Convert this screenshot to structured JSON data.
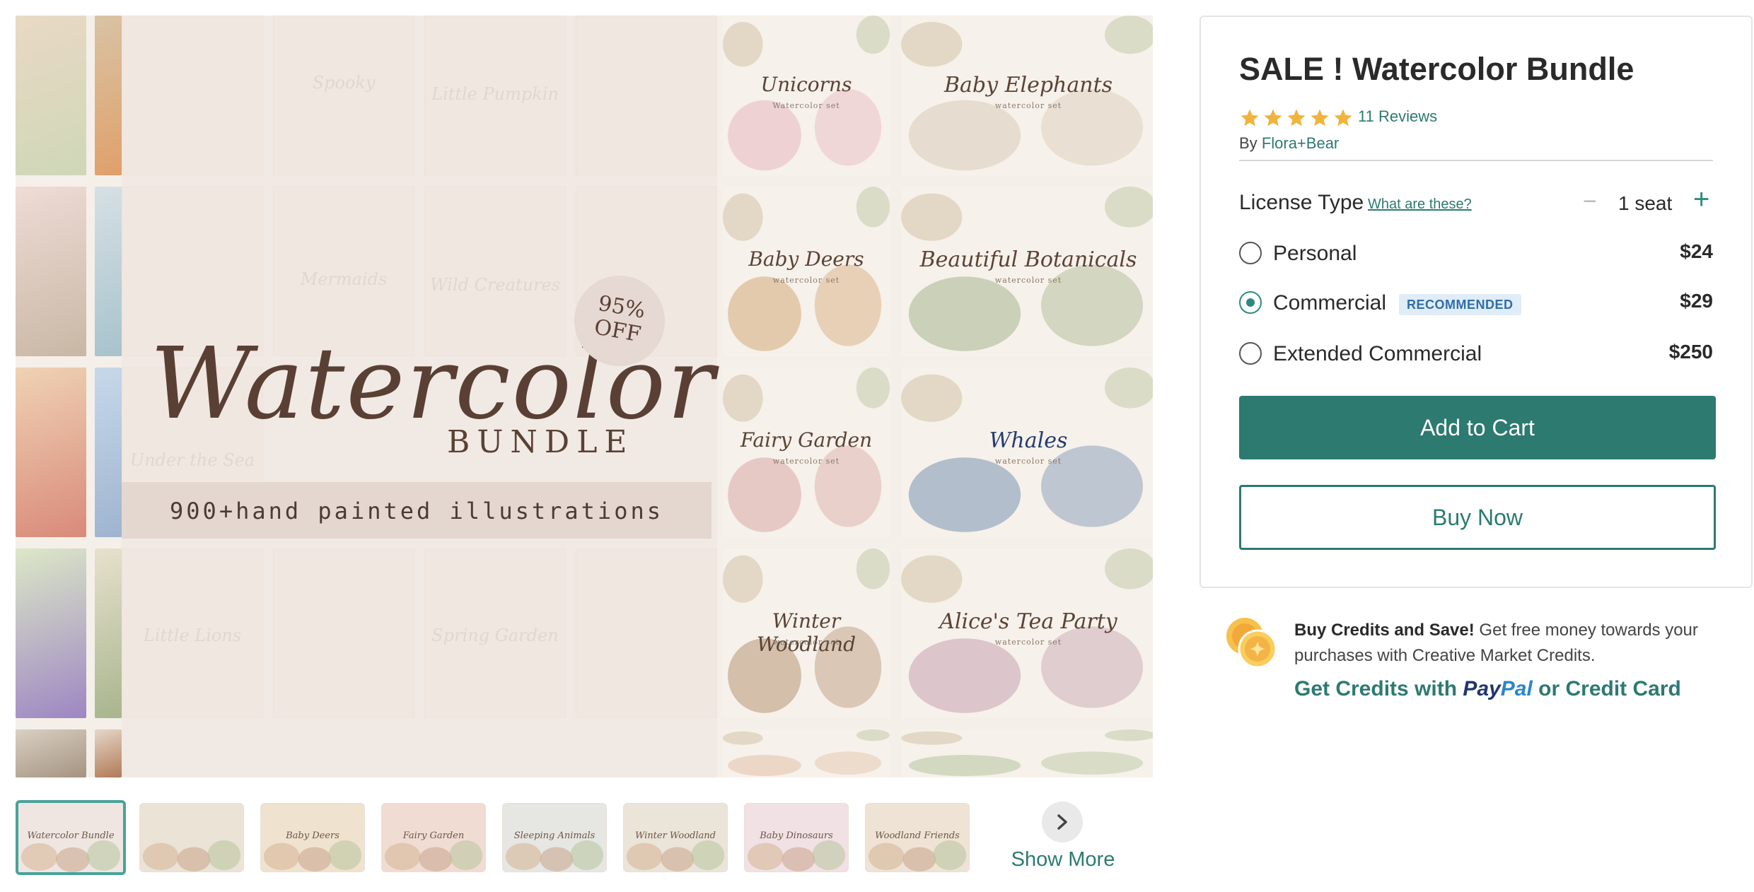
{
  "product": {
    "title": "SALE ! Watercolor Bundle",
    "rating": 5,
    "reviews_label": "11 Reviews",
    "author_prefix": "By",
    "author_name": "Flora+Bear"
  },
  "license": {
    "label": "License Type",
    "help_link": "What are these?",
    "seats_label": "1 seat",
    "minus_symbol": "−",
    "plus_symbol": "+",
    "options": [
      {
        "label": "Personal",
        "price": "$24",
        "selected": false,
        "badge": ""
      },
      {
        "label": "Commercial",
        "price": "$29",
        "selected": true,
        "badge": "RECOMMENDED"
      },
      {
        "label": "Extended Commercial",
        "price": "$250",
        "selected": false,
        "badge": ""
      }
    ]
  },
  "actions": {
    "add_to_cart": "Add to Cart",
    "buy_now": "Buy Now"
  },
  "credits": {
    "headline": "Buy Credits and Save!",
    "body": "Get free money towards your purchases with Creative Market Credits.",
    "link_prefix": "Get Credits with",
    "paypal_a": "Pay",
    "paypal_b": "Pal",
    "link_suffix": "or Credit Card"
  },
  "preview": {
    "hero_script": "Watercolor",
    "hero_bundle": "BUNDLE",
    "hero_band": "900+hand painted illustrations",
    "discount": "95%\nOFF",
    "right_tiles": [
      {
        "title": "Unicorns",
        "subtitle": "Watercolor set",
        "accent": "#e8b8c0"
      },
      {
        "title": "Baby Elephants",
        "subtitle": "watercolor set",
        "accent": "#d9cbb8"
      },
      {
        "title": "Baby Deers",
        "subtitle": "watercolor set",
        "accent": "#d6a979"
      },
      {
        "title": "Beautiful Botanicals",
        "subtitle": "watercolor set",
        "accent": "#a8b58e"
      },
      {
        "title": "Fairy Garden",
        "subtitle": "watercolor set",
        "accent": "#d9a8a6"
      },
      {
        "title": "Whales",
        "subtitle": "watercolor set",
        "accent": "#7a93b3"
      },
      {
        "title": "Winter Woodland",
        "subtitle": "watercolor set",
        "accent": "#b79575"
      },
      {
        "title": "Alice's Tea Party",
        "subtitle": "watercolor set",
        "accent": "#c6a1b0"
      },
      {
        "title": "",
        "subtitle": "",
        "accent": "#e3c0a8"
      },
      {
        "title": "",
        "subtitle": "",
        "accent": "#b5c49c"
      }
    ],
    "ghost_labels": [
      "Spooky",
      "Little Pumpkin",
      "Mermaids",
      "Wild Creatures",
      "Under the Sea",
      "Little Lions",
      "Spring Garden"
    ]
  },
  "thumbnails": [
    {
      "label": "Watercolor Bundle",
      "tint": "#efe6e1",
      "selected": true
    },
    {
      "label": "",
      "tint": "#eae3d6",
      "selected": false
    },
    {
      "label": "Baby Deers",
      "tint": "#efe2cf",
      "selected": false
    },
    {
      "label": "Fairy Garden",
      "tint": "#f0dcd3",
      "selected": false
    },
    {
      "label": "Sleeping Animals",
      "tint": "#e6e6e2",
      "selected": false
    },
    {
      "label": "Winter Woodland",
      "tint": "#ebe4d8",
      "selected": false
    },
    {
      "label": "Baby Dinosaurs",
      "tint": "#f1e1e4",
      "selected": false
    },
    {
      "label": "Woodland Friends",
      "tint": "#eee3d4",
      "selected": false
    }
  ],
  "show_more": "Show More",
  "colors": {
    "brand": "#2c7a70",
    "link": "#2d7a72",
    "star": "#f2b33d",
    "badge_bg": "#e0ecf7",
    "badge_text": "#2f6fa8"
  }
}
